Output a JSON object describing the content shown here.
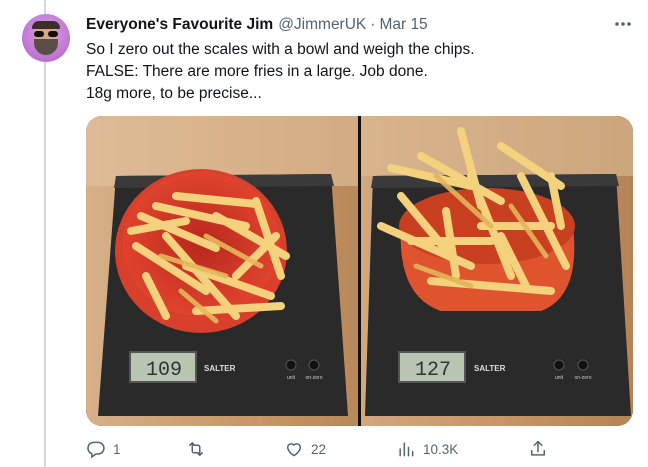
{
  "tweet": {
    "author_name": "Everyone's Favourite Jim",
    "handle": "@JimmerUK",
    "separator": "·",
    "date": "Mar 15",
    "text_lines": [
      "So I zero out the scales with a bowl and weigh the chips.",
      "FALSE: There are more fries in a large. Job done.",
      "18g more, to be precise..."
    ]
  },
  "media": {
    "left": {
      "scale_reading": "109",
      "brand": "SALTER",
      "button_labels": [
        "unit",
        "on-zero"
      ]
    },
    "right": {
      "scale_reading": "127",
      "brand": "SALTER",
      "button_labels": [
        "unit",
        "on-zero"
      ]
    }
  },
  "actions": {
    "replies": "1",
    "retweets": "",
    "likes": "22",
    "views": "10.3K"
  },
  "icons": {
    "more": "more-horizontal-icon",
    "reply": "reply-icon",
    "retweet": "retweet-icon",
    "like": "like-icon",
    "views": "views-icon",
    "share": "share-icon"
  },
  "colors": {
    "muted": "#536471",
    "bowl": "#e8452f",
    "scale_body": "#2b2b2b",
    "counter_wood": "#c9996a"
  }
}
